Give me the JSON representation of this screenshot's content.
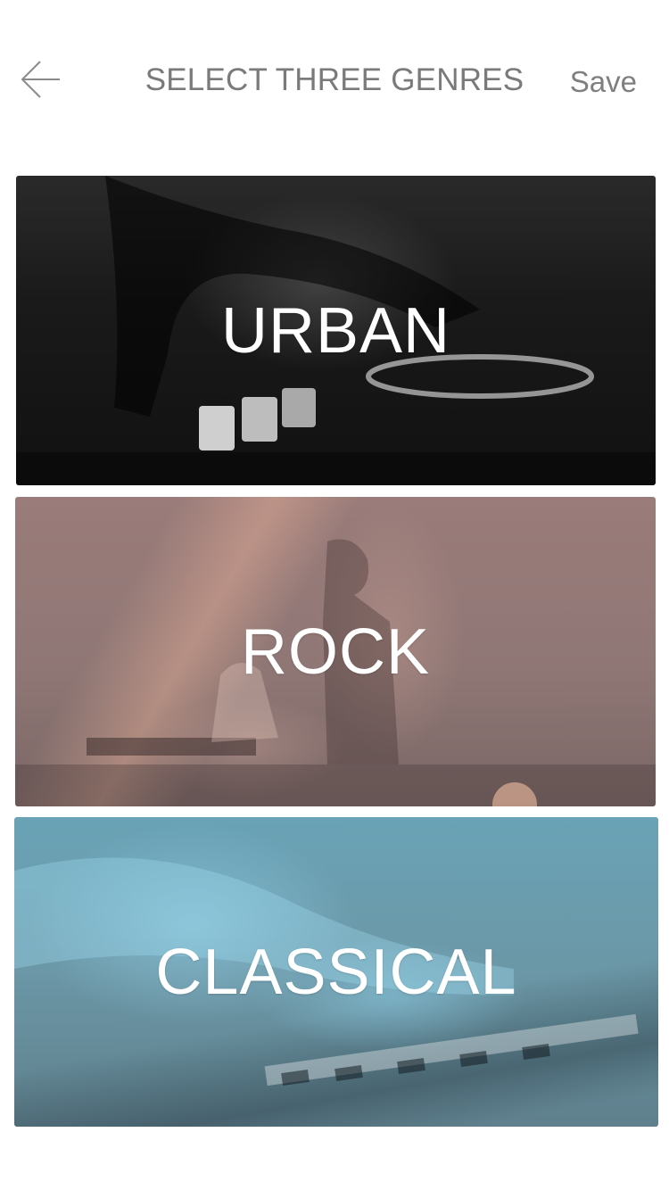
{
  "header": {
    "title": "SELECT THREE GENRES",
    "save_label": "Save",
    "back_icon": "arrow-left-icon"
  },
  "genres": [
    {
      "label": "URBAN",
      "tint": "#1e1e1e"
    },
    {
      "label": "ROCK",
      "tint": "#927776"
    },
    {
      "label": "CLASSICAL",
      "tint": "#6a9cad"
    }
  ],
  "colors": {
    "header_text": "#7a7a7a",
    "label_text": "#ffffff"
  }
}
